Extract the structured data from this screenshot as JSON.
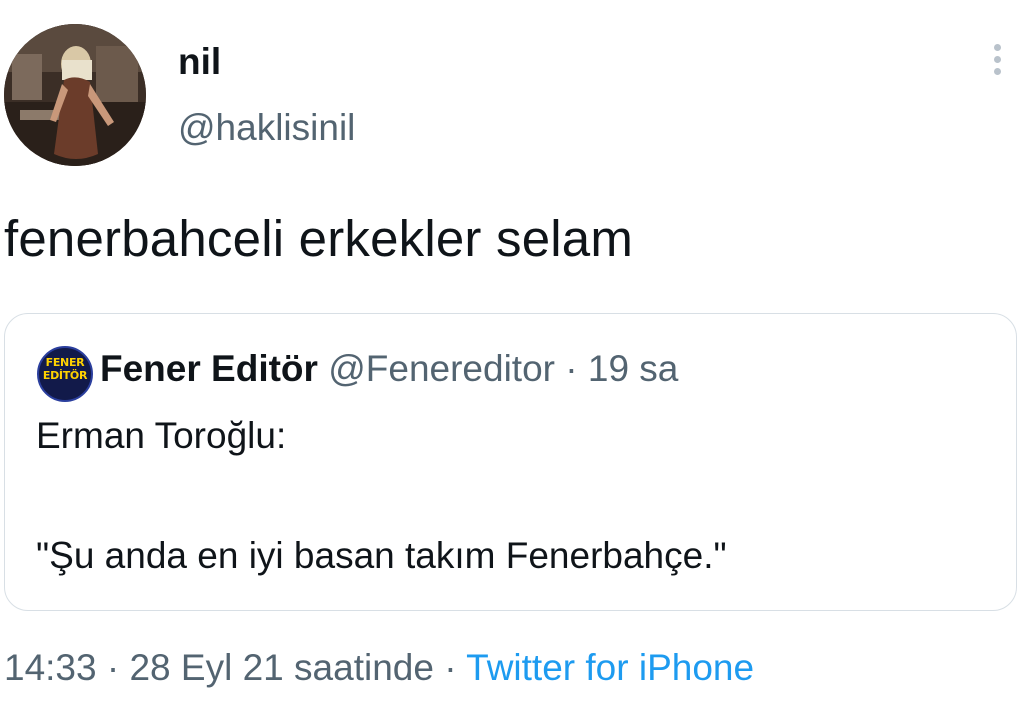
{
  "tweet": {
    "author": {
      "display_name": "nil",
      "handle": "@haklisinil"
    },
    "more_icon": "more-vertical-icon",
    "text": "fenerbahceli erkekler selam",
    "quoted": {
      "avatar_text": "FENER\nEDİTÖR",
      "display_name": "Fener Editör",
      "handle": "@Fenereditor",
      "separator": "·",
      "time_ago": "19 sa",
      "line1": "Erman Toroğlu:",
      "line2": "\"Şu anda en iyi basan takım Fenerbahçe.\""
    },
    "footer": {
      "time": "14:33",
      "separator1": "·",
      "date": "28 Eyl 21 saatinde",
      "separator2": "·",
      "source": "Twitter for iPhone"
    }
  },
  "colors": {
    "text_primary": "#0f1419",
    "text_secondary": "#536471",
    "link": "#1d9bf0",
    "border": "#d8dfe5"
  }
}
